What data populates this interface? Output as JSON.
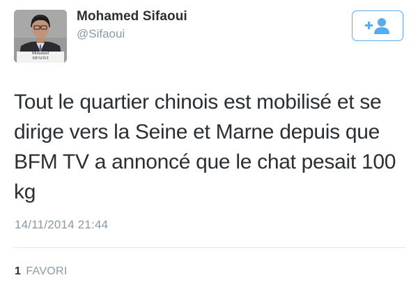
{
  "user": {
    "display_name": "Mohamed Sifaoui",
    "handle": "@Sifaoui",
    "avatar_caption_line1": "Mohamed",
    "avatar_caption_line2": "SIFAOUI"
  },
  "tweet": {
    "text": "Tout le quartier chinois est mobilisé et se dirige vers la Seine et Marne depuis que BFM TV a annoncé que le chat pesait 100 kg",
    "timestamp": "14/11/2014 21:44"
  },
  "stats": {
    "favorites_count": "1",
    "favorites_label": "FAVORI"
  },
  "colors": {
    "accent": "#55acee",
    "text": "#292f33",
    "muted": "#8899a6",
    "divider": "#e1e8ed"
  },
  "icons": {
    "follow": "add-user-icon"
  }
}
